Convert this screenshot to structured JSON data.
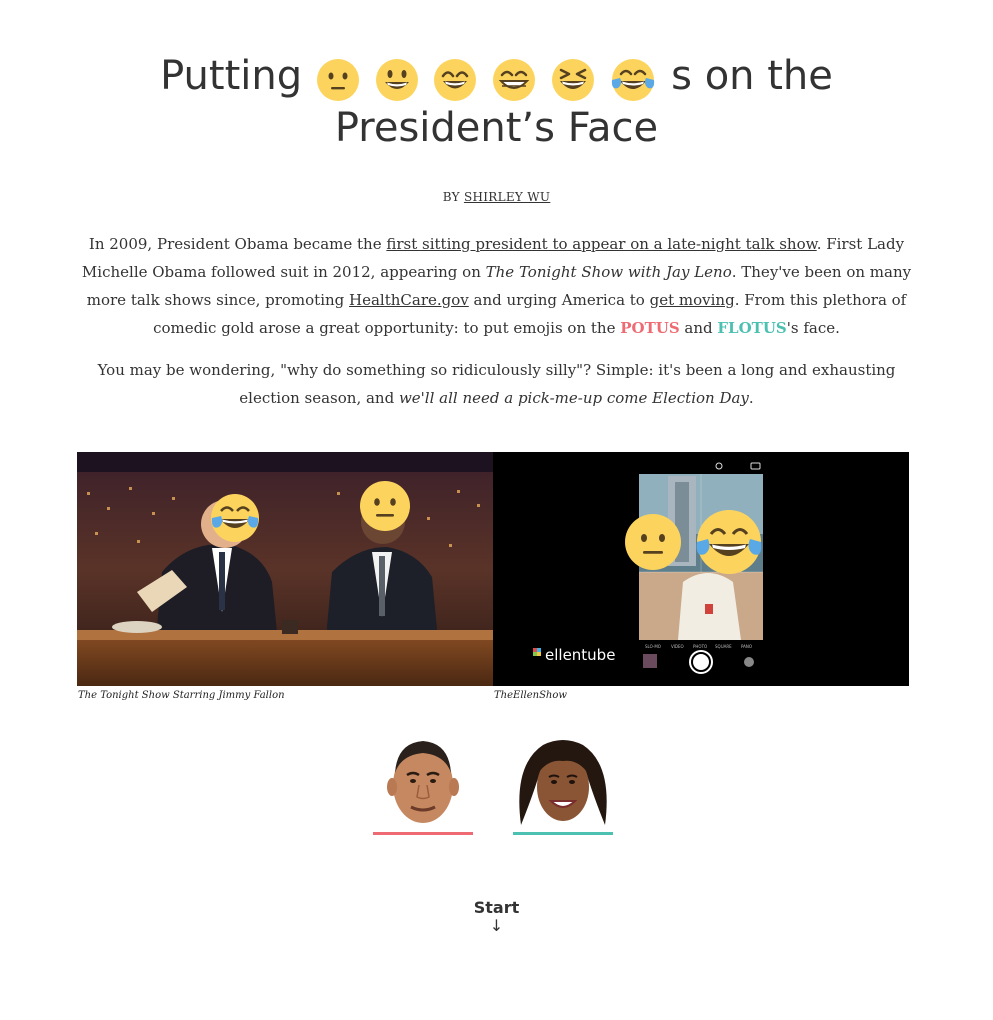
{
  "header": {
    "title_prefix": "Putting ",
    "title_suffix": "s on the",
    "title_line2": "President’s Face",
    "title_emojis": [
      "neutral-face",
      "grinning-face",
      "grinning-smiling-eyes",
      "beaming-face",
      "squinting-face",
      "tears-of-joy"
    ]
  },
  "byline": {
    "prefix": "BY ",
    "author": "SHIRLEY WU"
  },
  "intro": {
    "p1": {
      "t1": "In 2009, President Obama became the ",
      "link1": "first sitting president to appear on a late-night talk show",
      "t2": ". First Lady Michelle Obama followed suit in 2012, appearing on ",
      "show": "The Tonight Show with Jay Leno",
      "t3": ". They've been on many more talk shows since, promoting ",
      "link2": "HealthCare.gov",
      "t4": " and urging America to ",
      "link3": "get moving",
      "t5": ". From this plethora of comedic gold arose a great opportunity: to put emojis on the ",
      "potus": "POTUS",
      "t6": " and ",
      "flotus": "FLOTUS",
      "t7": "'s face."
    },
    "p2": {
      "t1": "You may be wondering, \"why do something so ridiculously silly\"? Simple: it's been a long and exhausting election season, and ",
      "em": "we'll all need a pick-me-up come Election Day",
      "t2": "."
    }
  },
  "videos": {
    "left_caption": "The Tonight Show Starring Jimmy Fallon",
    "right_caption": "TheEllenShow",
    "right_logo": "ellentube",
    "camera_modes": [
      "SLO-MO",
      "VIDEO",
      "PHOTO",
      "SQUARE",
      "PANO"
    ]
  },
  "faces": {
    "potus_color": "#ef6b73",
    "flotus_color": "#4cc1b2"
  },
  "start": {
    "label": "Start",
    "arrow": "↓"
  }
}
